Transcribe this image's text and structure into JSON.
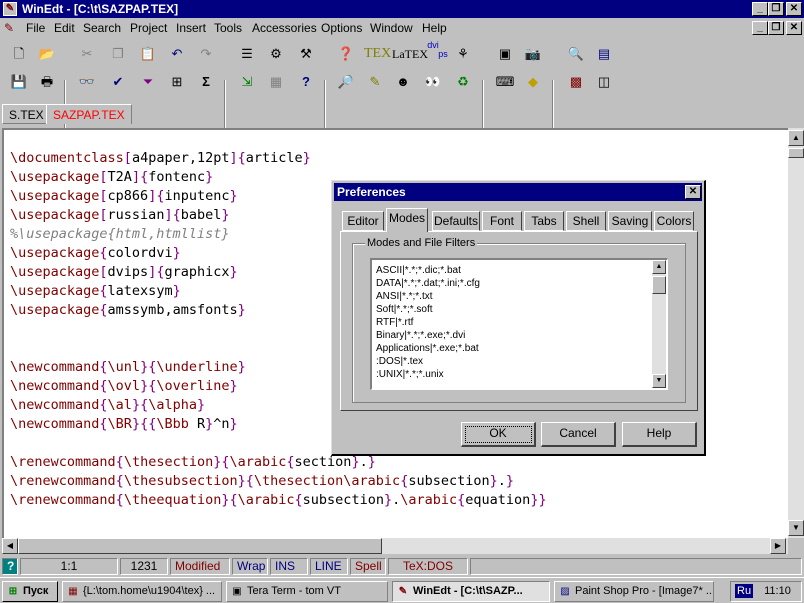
{
  "window": {
    "title": "WinEdt - [C:\\t\\SAZPAP.TEX]"
  },
  "menu": [
    "File",
    "Edit",
    "Search",
    "Project",
    "Insert",
    "Tools",
    "Accessories",
    "Options",
    "Window",
    "Help"
  ],
  "toolbar_text": {
    "tex": "TEX",
    "latex": "LaTEX",
    "dvi": "dvi",
    "ps": "ps",
    "sigma": "Σ",
    "help": "?"
  },
  "file_tabs": [
    {
      "label": "S.TEX",
      "active": false
    },
    {
      "label": "SAZPAP.TEX",
      "active": true
    }
  ],
  "editor_lines": [
    [
      [
        "cmd",
        "\\documentclass"
      ],
      [
        "brace",
        "["
      ],
      [
        "arg",
        "a4paper,12pt"
      ],
      [
        "brace",
        "]{"
      ],
      [
        "arg",
        "article"
      ],
      [
        "brace",
        "}"
      ]
    ],
    [
      [
        "cmd",
        "\\usepackage"
      ],
      [
        "brace",
        "["
      ],
      [
        "arg",
        "T2A"
      ],
      [
        "brace",
        "]{"
      ],
      [
        "arg",
        "fontenc"
      ],
      [
        "brace",
        "}"
      ]
    ],
    [
      [
        "cmd",
        "\\usepackage"
      ],
      [
        "brace",
        "["
      ],
      [
        "arg",
        "cp866"
      ],
      [
        "brace",
        "]{"
      ],
      [
        "arg",
        "inputenc"
      ],
      [
        "brace",
        "}"
      ]
    ],
    [
      [
        "cmd",
        "\\usepackage"
      ],
      [
        "brace",
        "["
      ],
      [
        "arg",
        "russian"
      ],
      [
        "brace",
        "]{"
      ],
      [
        "arg",
        "babel"
      ],
      [
        "brace",
        "}"
      ]
    ],
    [
      [
        "cmt",
        "%\\usepackage{html,htmllist}"
      ]
    ],
    [
      [
        "cmd",
        "\\usepackage"
      ],
      [
        "brace",
        "{"
      ],
      [
        "arg",
        "colordvi"
      ],
      [
        "brace",
        "}"
      ]
    ],
    [
      [
        "cmd",
        "\\usepackage"
      ],
      [
        "brace",
        "["
      ],
      [
        "arg",
        "dvips"
      ],
      [
        "brace",
        "]{"
      ],
      [
        "arg",
        "graphicx"
      ],
      [
        "brace",
        "}"
      ]
    ],
    [
      [
        "cmd",
        "\\usepackage"
      ],
      [
        "brace",
        "{"
      ],
      [
        "arg",
        "latexsym"
      ],
      [
        "brace",
        "}"
      ]
    ],
    [
      [
        "cmd",
        "\\usepackage"
      ],
      [
        "brace",
        "{"
      ],
      [
        "arg",
        "amssymb,amsfonts"
      ],
      [
        "brace",
        "}"
      ]
    ],
    [],
    [],
    [
      [
        "cmd",
        "\\newcommand"
      ],
      [
        "brace",
        "{"
      ],
      [
        "cmd",
        "\\unl"
      ],
      [
        "brace",
        "}{"
      ],
      [
        "cmd",
        "\\underline"
      ],
      [
        "brace",
        "}"
      ]
    ],
    [
      [
        "cmd",
        "\\newcommand"
      ],
      [
        "brace",
        "{"
      ],
      [
        "cmd",
        "\\ovl"
      ],
      [
        "brace",
        "}{"
      ],
      [
        "cmd",
        "\\overline"
      ],
      [
        "brace",
        "}"
      ]
    ],
    [
      [
        "cmd",
        "\\newcommand"
      ],
      [
        "brace",
        "{"
      ],
      [
        "cmd",
        "\\al"
      ],
      [
        "brace",
        "}{"
      ],
      [
        "cmd",
        "\\alpha"
      ],
      [
        "brace",
        "}"
      ]
    ],
    [
      [
        "cmd",
        "\\newcommand"
      ],
      [
        "brace",
        "{"
      ],
      [
        "cmd",
        "\\BR"
      ],
      [
        "brace",
        "}{{"
      ],
      [
        "cmd",
        "\\Bbb"
      ],
      [
        "arg",
        " R"
      ],
      [
        "brace",
        "}"
      ],
      [
        "arg",
        "^n"
      ],
      [
        "brace",
        "}"
      ]
    ],
    [],
    [
      [
        "cmd",
        "\\renewcommand"
      ],
      [
        "brace",
        "{"
      ],
      [
        "cmd",
        "\\thesection"
      ],
      [
        "brace",
        "}{"
      ],
      [
        "cmd",
        "\\arabic"
      ],
      [
        "brace",
        "{"
      ],
      [
        "arg",
        "section"
      ],
      [
        "brace",
        "}"
      ],
      [
        "arg",
        "."
      ],
      [
        "brace",
        "}"
      ]
    ],
    [
      [
        "cmd",
        "\\renewcommand"
      ],
      [
        "brace",
        "{"
      ],
      [
        "cmd",
        "\\thesubsection"
      ],
      [
        "brace",
        "}{"
      ],
      [
        "cmd",
        "\\thesection\\arabic"
      ],
      [
        "brace",
        "{"
      ],
      [
        "arg",
        "subsection"
      ],
      [
        "brace",
        "}"
      ],
      [
        "arg",
        "."
      ],
      [
        "brace",
        "}"
      ]
    ],
    [
      [
        "cmd",
        "\\renewcommand"
      ],
      [
        "brace",
        "{"
      ],
      [
        "cmd",
        "\\theequation"
      ],
      [
        "brace",
        "}{"
      ],
      [
        "cmd",
        "\\arabic"
      ],
      [
        "brace",
        "{"
      ],
      [
        "arg",
        "subsection"
      ],
      [
        "brace",
        "}"
      ],
      [
        "arg",
        "."
      ],
      [
        "cmd",
        "\\arabic"
      ],
      [
        "brace",
        "{"
      ],
      [
        "arg",
        "equation"
      ],
      [
        "brace",
        "}}"
      ]
    ]
  ],
  "status": {
    "help": "?",
    "position": "1:1",
    "lines": "1231",
    "modified": "Modified",
    "wrap": "Wrap",
    "ins": "INS",
    "line": "LINE",
    "spell": "Spell",
    "mode": "TeX:DOS"
  },
  "dialog": {
    "title": "Preferences",
    "tabs": [
      "Editor",
      "Modes",
      "Defaults",
      "Font",
      "Tabs",
      "Shell",
      "Saving",
      "Colors"
    ],
    "active_tab": "Modes",
    "group_label": "Modes and File Filters",
    "items": [
      "ASCII|*.*;*.dic;*.bat",
      "DATA|*.*;*.dat;*.ini;*.cfg",
      "ANSI|*.*;*.txt",
      "Soft|*.*;*.soft",
      "RTF|*.rtf",
      "Binary|*.*;*.exe;*.dvi",
      "Applications|*.exe;*.bat",
      ":DOS|*.tex",
      ":UNIX|*.*;*.unix"
    ],
    "ok": "OK",
    "cancel": "Cancel",
    "help": "Help"
  },
  "taskbar": {
    "start": "Пуск",
    "tasks": [
      "{L:\\tom.home\\u1904\\tex} ...",
      "Tera Term - tom VT",
      "WinEdt - [C:\\t\\SAZP...",
      "Paint Shop Pro - [Image7* ..."
    ],
    "lang": "Ru",
    "clock": "11:10"
  },
  "colors": {
    "title_bg": "#000080",
    "cmd": "#800000",
    "brace": "#800080",
    "comment": "#808080",
    "active_tab": "#ff0000"
  }
}
